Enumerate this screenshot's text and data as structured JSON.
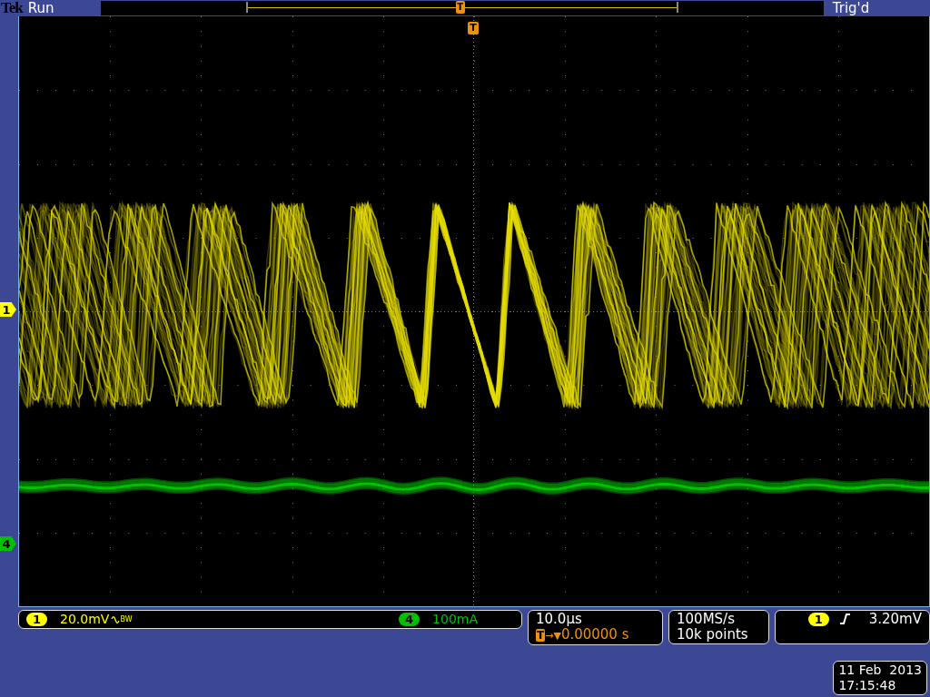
{
  "header": {
    "brand": "Tek",
    "acquisition_state": "Run",
    "trigger_status": "Trig'd",
    "record_marker": "T"
  },
  "trigger_position_marker": "T",
  "channel_markers": [
    {
      "label": "1",
      "color": "#ffff00"
    },
    {
      "label": "4",
      "color": "#00c000"
    }
  ],
  "vertical": [
    {
      "channel": "1",
      "scale": "20.0mV",
      "bandwidth_limit": "BW",
      "color": "#ffff00"
    },
    {
      "channel": "4",
      "scale": "100mA",
      "color": "#00c000"
    }
  ],
  "horizontal": {
    "scale": "10.0µs",
    "delay_marker": "T",
    "delay_arrow": "→▼",
    "delay": "0.00000 s"
  },
  "acquisition": {
    "sample_rate": "100MS/s",
    "record_length": "10k points"
  },
  "trigger": {
    "source": "1",
    "rising_edge": true,
    "level": "3.20mV",
    "color": "#ffff00"
  },
  "datetime": {
    "date": "11 Feb  2013",
    "time": "17:15:48"
  }
}
